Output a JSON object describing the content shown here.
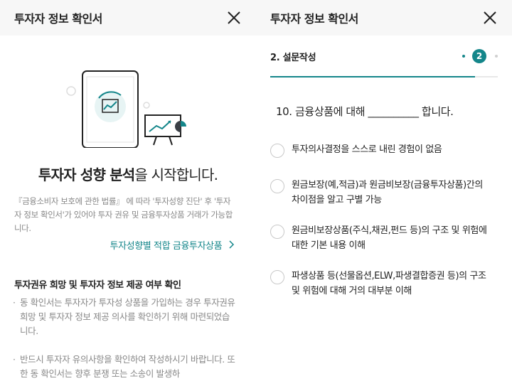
{
  "left": {
    "header": {
      "title": "투자자 정보 확인서",
      "close_icon": "close-icon"
    },
    "intro": {
      "heading_bold": "투자자 성향 분석",
      "heading_rest": "을 시작합니다.",
      "description": "『금융소비자 보호에 관한 법률』 에 따라 '투자성향 진단' 후 '투자자 정보 확인서'가 있어야 투자 권유 및 금융투자상품 거래가 가능합니다.",
      "product_link": "투자성향별 적합 금융투자상품",
      "link_icon": "chevron-right-icon"
    },
    "notice": {
      "title": "투자권유 희망 및 투자자 정보 제공 여부 확인",
      "bullet_marker": "·",
      "items": [
        "동 확인서는 투자자가 투자성 상품을 가입하는 경우 투자권유 희망 및 투자자 정보 제공 의사를 확인하기 위해 마련되었습니다.",
        "반드시 투자자 유의사항을 확인하여 작성하시기 바랍니다. 또한 동 확인서는 향후 분쟁 또는 소송이 발생하"
      ]
    }
  },
  "right": {
    "header": {
      "title": "투자자 정보 확인서",
      "close_icon": "close-icon"
    },
    "step": {
      "label": "2. 설문작성",
      "current": "2",
      "progress": 0.9
    },
    "question": "10. 금융상품에 대해 __________ 합니다.",
    "options": [
      "투자의사결정을 스스로 내린 경험이 없음",
      "원금보장(예,적금)과 원금비보장(금융투자상품)간의 차이점을 알고 구별 가능",
      "원금비보장상품(주식,채권,펀드 등)의 구조 및 위험에 대한 기본 내용 이해",
      "파생상품 등(선물옵션,ELW,파생결합증권 등)의 구조 및 위험에 대해 거의 대부분 이해"
    ]
  },
  "colors": {
    "accent": "#14868a",
    "header_bg": "#f7f7f7",
    "muted_text": "#888888"
  }
}
